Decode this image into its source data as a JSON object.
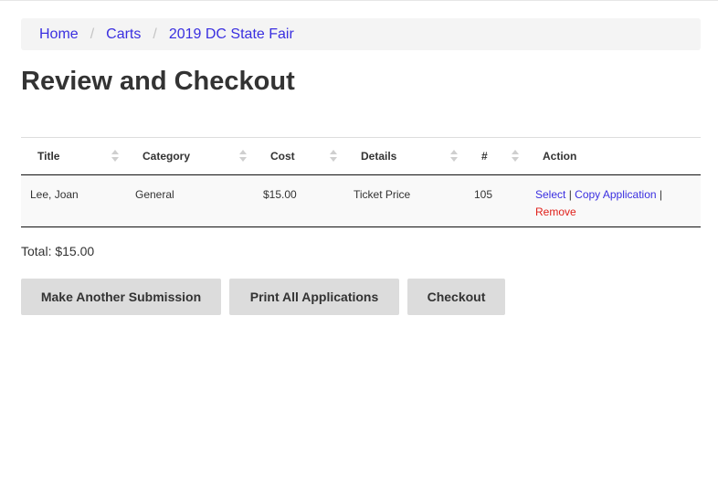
{
  "breadcrumb": {
    "items": [
      "Home",
      "Carts",
      "2019 DC State Fair"
    ],
    "separator": "/"
  },
  "page": {
    "title": "Review and Checkout"
  },
  "table": {
    "headers": [
      "Title",
      "Category",
      "Cost",
      "Details",
      "#",
      "Action"
    ],
    "rows": [
      {
        "title": "Lee, Joan",
        "category": "General",
        "cost": "$15.00",
        "details": "Ticket Price",
        "number": "105",
        "actions": {
          "select": "Select",
          "copy": "Copy Application",
          "remove": "Remove",
          "divider": "|"
        }
      }
    ]
  },
  "summary": {
    "total": "Total: $15.00"
  },
  "buttons": {
    "make_another": "Make Another Submission",
    "print_all": "Print All Applications",
    "checkout": "Checkout"
  },
  "colors": {
    "link": "#3a2fe0",
    "danger": "#e0201a",
    "button_bg": "#dcdcdc",
    "breadcrumb_bg": "#f4f4f4"
  }
}
